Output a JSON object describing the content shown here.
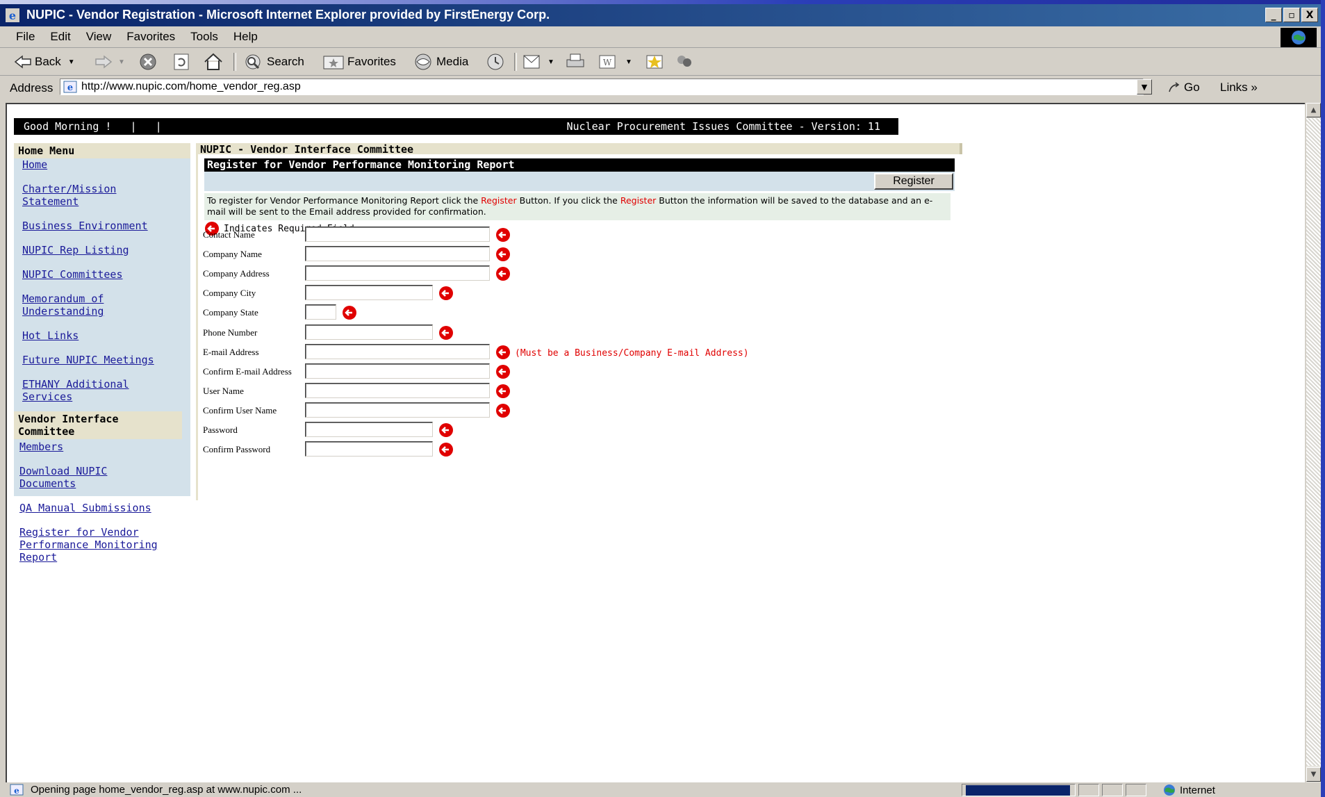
{
  "window": {
    "title": "NUPIC - Vendor Registration - Microsoft Internet Explorer provided by FirstEnergy Corp.",
    "controls": [
      "_",
      "▫",
      "X"
    ]
  },
  "menu": [
    "File",
    "Edit",
    "View",
    "Favorites",
    "Tools",
    "Help"
  ],
  "toolbar": {
    "back": "Back",
    "search": "Search",
    "favorites": "Favorites",
    "media": "Media"
  },
  "address": {
    "label": "Address",
    "url": "http://www.nupic.com/home_vendor_reg.asp",
    "go": "Go",
    "links": "Links"
  },
  "page": {
    "greeting": "Good Morning !   |   |",
    "committee_version": "Nuclear Procurement Issues Committee - Version: 11",
    "home_menu_title": "Home Menu",
    "home_menu": [
      "Home",
      "Charter/Mission Statement",
      "Business Environment",
      "NUPIC Rep Listing",
      "NUPIC Committees",
      "Memorandum of Understanding",
      "Hot Links",
      "Future NUPIC Meetings",
      "ETHANY Additional Services"
    ],
    "vendor_menu_title": "Vendor Interface Committee",
    "vendor_menu": [
      "Members",
      "Download NUPIC Documents",
      "QA Manual Submissions",
      "Register for Vendor Performance Monitoring Report"
    ],
    "main_title": "NUPIC - Vendor Interface Committee",
    "section_title": "Register for Vendor Performance Monitoring Report",
    "register_button": "Register",
    "info_part1": "To register for Vendor Performance Monitoring Report click the ",
    "info_register1": "Register",
    "info_part2": " Button. If you click the ",
    "info_register2": "Register",
    "info_part3": " Button the information will be saved to the database and an e-mail will be sent to the Email address provided for confirmation.",
    "required_legend": "Indicates Required Field",
    "fields": [
      {
        "label": "Contact Name",
        "value": ""
      },
      {
        "label": "Company Name",
        "value": ""
      },
      {
        "label": "Company Address",
        "value": ""
      },
      {
        "label": "Company City",
        "value": ""
      },
      {
        "label": "Company State",
        "value": ""
      },
      {
        "label": "Phone Number",
        "value": ""
      },
      {
        "label": "E-mail Address",
        "value": ""
      },
      {
        "label": "Confirm E-mail Address",
        "value": ""
      },
      {
        "label": "User Name",
        "value": ""
      },
      {
        "label": "Confirm User Name",
        "value": ""
      },
      {
        "label": "Password",
        "value": ""
      },
      {
        "label": "Confirm Password",
        "value": ""
      }
    ],
    "email_note": "(Must be a Business/Company E-mail Address)"
  },
  "status": {
    "text": "Opening page home_vendor_reg.asp at www.nupic.com ...",
    "zone": "Internet"
  },
  "colors": {
    "title_bar": "#0a246a",
    "link": "#1a1a99",
    "required": "#e00000",
    "sidebar": "#d3e1ea"
  }
}
